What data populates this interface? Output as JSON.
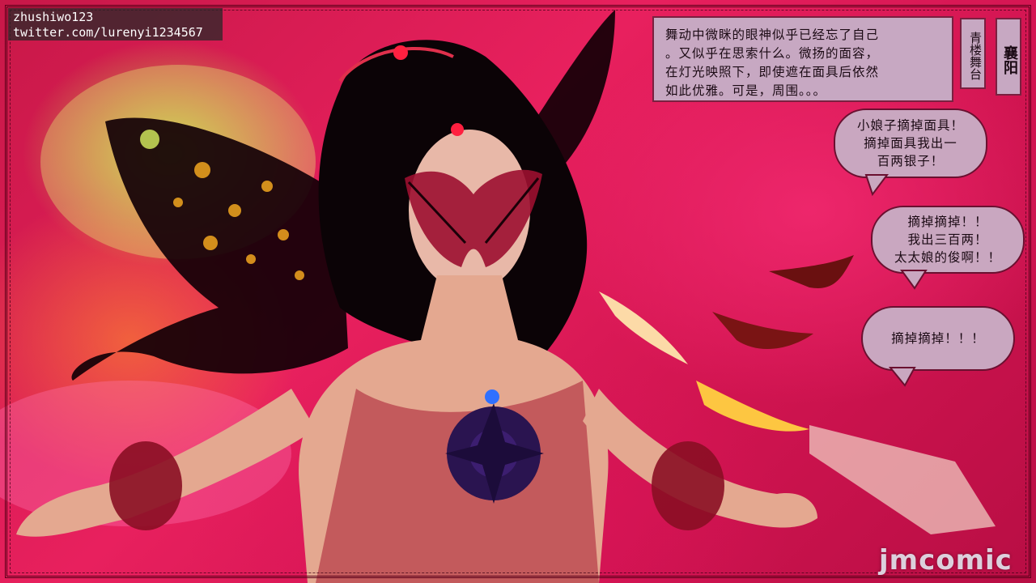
{
  "watermark": {
    "line1": "zhushiwo123",
    "line2": "twitter.com/lurenyi1234567"
  },
  "narration": {
    "lines": [
      "舞动中微眯的眼神似乎已经忘了自己",
      "。又似乎在思索什么。微扬的面容，",
      "在灯光映照下，即使遮在面具后依然",
      "如此优雅。可是，周围。。。"
    ]
  },
  "location_tags": {
    "venue": "青楼舞台",
    "city": "襄阳"
  },
  "speech_bubbles": [
    {
      "lines": [
        "小娘子摘掉面具！",
        "摘掉面具我出一",
        "百两银子！"
      ]
    },
    {
      "lines": [
        "摘掉摘掉！！",
        "我出三百两！",
        "太太娘的俊啊！！"
      ]
    },
    {
      "lines": [
        "摘掉摘掉！！！"
      ]
    }
  ],
  "logo": "jmcomic",
  "colors": {
    "background": "#d01450",
    "bubble": "#c9a7c0",
    "border": "#6a1030"
  }
}
